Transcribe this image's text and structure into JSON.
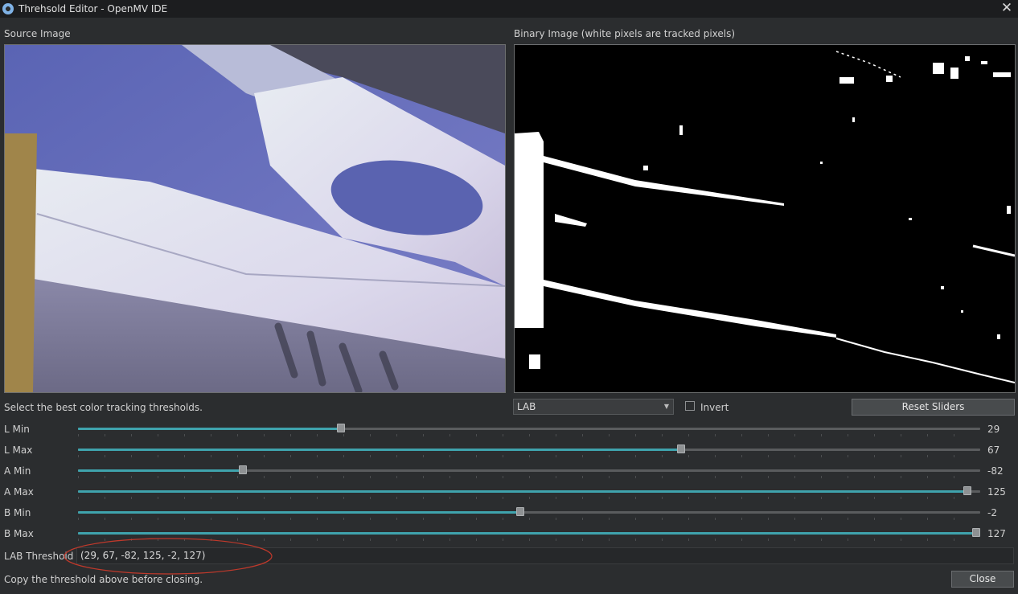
{
  "window": {
    "title": "Threhsold Editor - OpenMV IDE",
    "close_glyph": "✕"
  },
  "source_image": {
    "label": "Source Image"
  },
  "binary_image": {
    "label": "Binary Image (white pixels are tracked pixels)"
  },
  "instructions": "Select the best color tracking thresholds.",
  "color_space": {
    "selected": "LAB"
  },
  "invert": {
    "label": "Invert",
    "checked": false
  },
  "reset_button": {
    "label": "Reset Sliders"
  },
  "sliders": [
    {
      "label": "L Min",
      "value": "29",
      "fraction": 0.29
    },
    {
      "label": "L Max",
      "value": "67",
      "fraction": 0.67
    },
    {
      "label": "A Min",
      "value": "-82",
      "fraction": 0.18
    },
    {
      "label": "A Max",
      "value": "125",
      "fraction": 0.99
    },
    {
      "label": "B Min",
      "value": "-2",
      "fraction": 0.49
    },
    {
      "label": "B Max",
      "value": "127",
      "fraction": 1.0
    }
  ],
  "threshold": {
    "label": "LAB Threshold",
    "value": "(29, 67, -82, 125, -2, 127)"
  },
  "footer_text": "Copy the threshold above before closing.",
  "close_button": {
    "label": "Close"
  },
  "colors": {
    "background": "#2b2d2f",
    "slider_fill": "#3fa3ad",
    "annotation_ellipse": "#c0392b"
  }
}
